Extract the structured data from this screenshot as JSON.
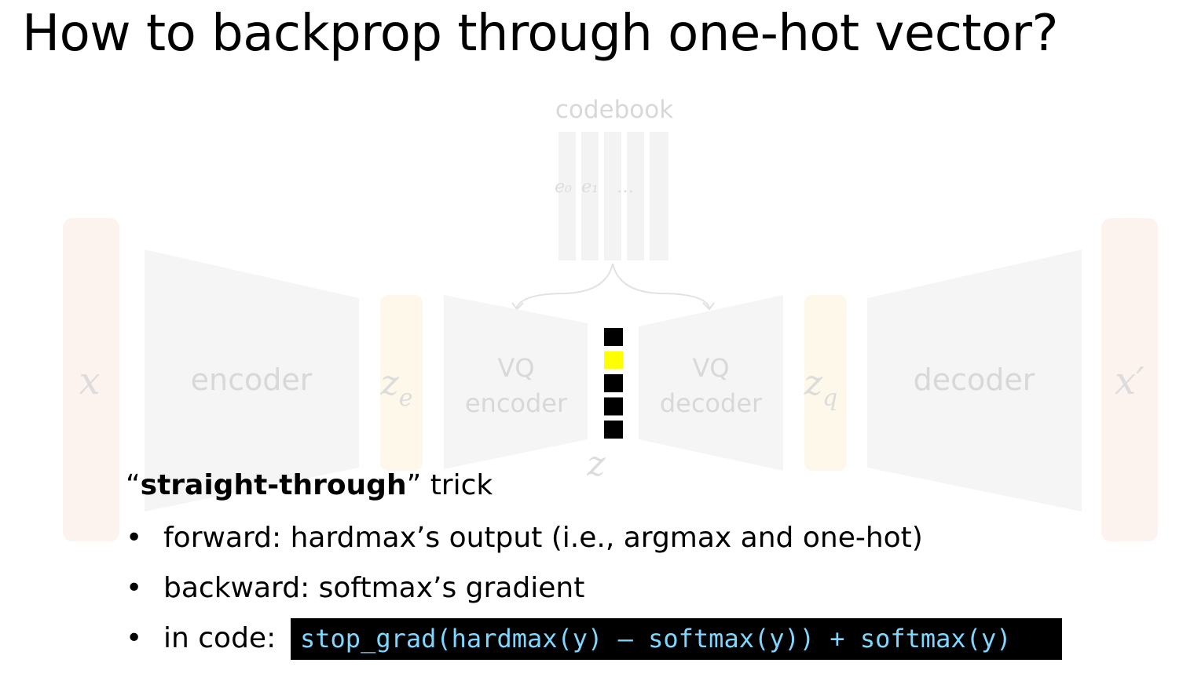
{
  "title": "How to backprop through one-hot vector?",
  "diagram": {
    "codebook_label": "codebook",
    "codebook_entries": [
      "e₀",
      "e₁",
      "…"
    ],
    "input_label": "x",
    "encoder_label": "encoder",
    "ze_label": "z",
    "ze_sub": "e",
    "vq_encoder_line1": "VQ",
    "vq_encoder_line2": "encoder",
    "vq_decoder_line1": "VQ",
    "vq_decoder_line2": "decoder",
    "z_label": "z",
    "zq_label": "z",
    "zq_sub": "q",
    "decoder_label": "decoder",
    "output_label": "x′",
    "one_hot": [
      0,
      1,
      0,
      0,
      0
    ],
    "colors": {
      "one_hot_active": "#ffff00",
      "one_hot_inactive": "#000000",
      "io_bar": "#fdf3ee",
      "latent_bar": "#fdf8ea",
      "block": "#f5f5f5"
    }
  },
  "trick": {
    "quote_open": "“",
    "bold": "straight-through",
    "quote_close": "”",
    "rest": " trick"
  },
  "bullets": [
    {
      "marker": "•",
      "text": "forward: hardmax’s output (i.e., argmax and one-hot)"
    },
    {
      "marker": "•",
      "text": "backward: softmax’s gradient"
    },
    {
      "marker": "•",
      "text": "in code:"
    }
  ],
  "code": "stop_grad(hardmax(y) – softmax(y)) + softmax(y)"
}
